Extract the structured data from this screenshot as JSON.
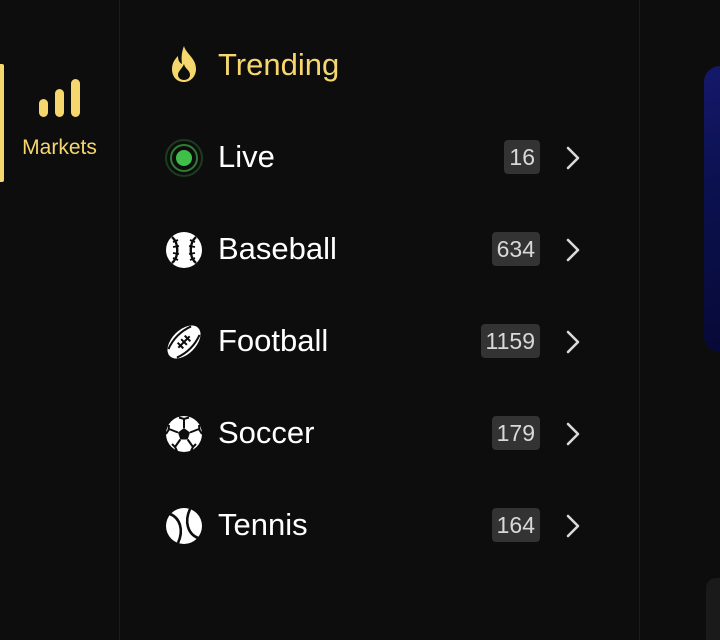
{
  "rail": {
    "items": [
      {
        "label": "Markets",
        "icon": "bar-chart-icon",
        "active": true
      }
    ]
  },
  "menu": {
    "items": [
      {
        "label": "Trending",
        "icon": "flame-icon",
        "count": null
      },
      {
        "label": "Live",
        "icon": "live-dot-icon",
        "count": "16"
      },
      {
        "label": "Baseball",
        "icon": "baseball-icon",
        "count": "634"
      },
      {
        "label": "Football",
        "icon": "football-icon",
        "count": "1159"
      },
      {
        "label": "Soccer",
        "icon": "soccer-ball-icon",
        "count": "179"
      },
      {
        "label": "Tennis",
        "icon": "tennis-ball-icon",
        "count": "164"
      }
    ]
  },
  "colors": {
    "accent": "#f5d76e",
    "background": "#0d0d0d",
    "badge": "#333333",
    "live": "#3fbf4a",
    "banner": "#0b1150"
  }
}
